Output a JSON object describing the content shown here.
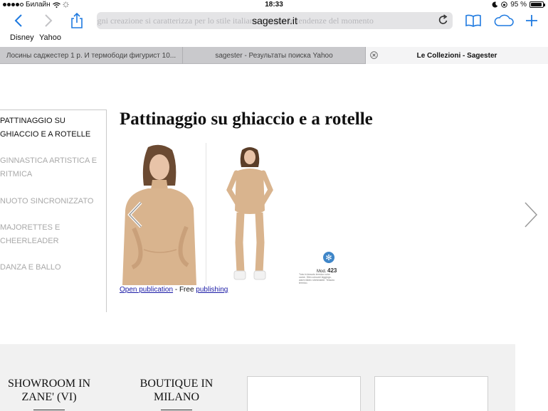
{
  "status": {
    "carrier": "Билайн",
    "time": "18:33",
    "battery": "95 %",
    "battery_level": 0.95
  },
  "toolbar": {
    "url": "sagester.it",
    "ghost_text": "Ogni creazione si caratterizza per lo stile italiano e segue le tendenze del momento"
  },
  "bookmarks": [
    "Disney",
    "Yahoo"
  ],
  "tabs": [
    {
      "title": "Лосины саджестер 1 р. И термободи фигурист 10..."
    },
    {
      "title": "sagester - Результаты поиска Yahoo"
    },
    {
      "title": "Le Collezioni - Sagester"
    }
  ],
  "sidebar": {
    "items": [
      {
        "label": "Pattinaggio su ghiaccio e a rotelle",
        "active": true
      },
      {
        "label": "Ginnastica artistica e ritmica",
        "active": false
      },
      {
        "label": "Nuoto sincronizzato",
        "active": false
      },
      {
        "label": "Majorettes e cheerleader",
        "active": false
      },
      {
        "label": "Danza e ballo",
        "active": false
      }
    ]
  },
  "main": {
    "title": "Pattinaggio su ghiaccio e a rotelle",
    "model_prefix": "Mod.",
    "model_number": "423",
    "model_description": "Tuta in tessuto termico color carne. Slim colourel leggings, warm fabric stretchable. Tessuto termico.",
    "open_publication": "Open publication",
    "separator": " - Free ",
    "publishing": "publishing"
  },
  "footer": {
    "col1": [
      "SHOWROOM IN",
      "ZANE' (VI)"
    ],
    "col2": [
      "BOUTIQUE IN",
      "MILANO"
    ]
  },
  "colors": {
    "accent": "#1f7ae0",
    "muted_nav": "#a9a9a9",
    "footer_bg": "#f1f1f1",
    "link": "#1a1aa6",
    "tab_bar": "#c9c9cc"
  },
  "icons": [
    "back-arrow-icon",
    "forward-arrow-icon",
    "share-icon",
    "reload-icon",
    "reading-list-icon",
    "icloud-tabs-icon",
    "new-tab-icon",
    "tab-close-icon",
    "chevron-left-icon",
    "chevron-right-icon",
    "snowflake-icon"
  ]
}
